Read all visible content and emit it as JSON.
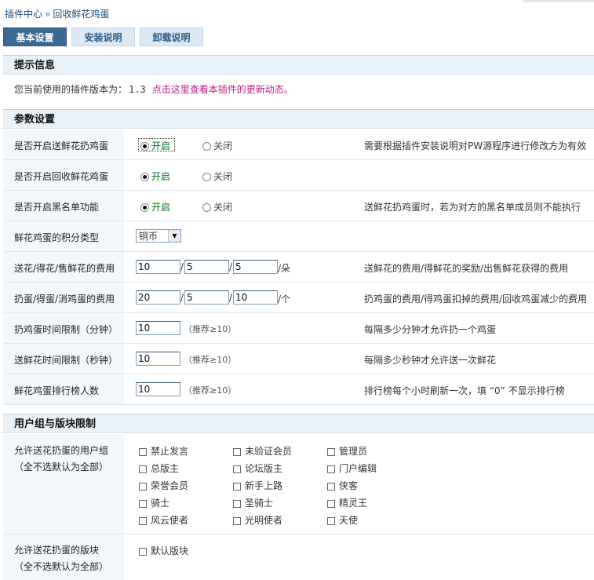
{
  "breadcrumb": {
    "home": "插件中心",
    "sep": "»",
    "current": "回收鲜花鸡蛋"
  },
  "tabs": [
    "基本设置",
    "安装说明",
    "卸载说明"
  ],
  "sections": {
    "notice": "提示信息",
    "params": "参数设置",
    "groups": "用户组与版块限制"
  },
  "notice": {
    "text": "您当前使用的插件版本为：",
    "version": "1.3",
    "link": "点击这里查看本插件的更新动态。"
  },
  "radio_labels": {
    "on": "开启",
    "off": "关闭"
  },
  "settings": {
    "r1": {
      "label": "是否开启送鲜花扔鸡蛋",
      "note": "需要根据插件安装说明对PW源程序进行修改方为有效"
    },
    "r2": {
      "label": "是否开启回收鲜花鸡蛋"
    },
    "r3": {
      "label": "是否开启黑名单功能",
      "note": "送鲜花扔鸡蛋时，若为对方的黑名单成员则不能执行"
    },
    "r4": {
      "label": "鲜花鸡蛋的积分类型",
      "select": "铜币"
    },
    "r5": {
      "label": "送花/得花/售鲜花的费用",
      "v1": "10",
      "v2": "5",
      "v3": "5",
      "unit": "朵",
      "note": "送鲜花的费用/得鲜花的奖励/出售鲜花获得的费用"
    },
    "r6": {
      "label": "扔蛋/得蛋/消鸡蛋的费用",
      "v1": "20",
      "v2": "5",
      "v3": "10",
      "unit": "个",
      "note": "扔鸡蛋的费用/得鸡蛋扣掉的费用/回收鸡蛋减少的费用"
    },
    "r7": {
      "label": "扔鸡蛋时间限制（分钟）",
      "v1": "10",
      "hint": "（推荐≥10）",
      "note": "每隔多少分钟才允许扔一个鸡蛋"
    },
    "r8": {
      "label": "送鲜花时间限制（秒钟）",
      "v1": "10",
      "hint": "（推荐≥10）",
      "note": "每隔多少秒钟才允许送一次鲜花"
    },
    "r9": {
      "label": "鲜花鸡蛋排行榜人数",
      "v1": "10",
      "hint": "（推荐≥10）",
      "note": "排行榜每个小时刷新一次，填 “0” 不显示排行榜"
    }
  },
  "groups": {
    "label1": "允许送花扔蛋的用户组",
    "sub": "（全不选默认为全部）",
    "items": [
      "禁止发言",
      "未验证会员",
      "管理员",
      "总版主",
      "论坛版主",
      "门户编辑",
      "荣誉会员",
      "新手上路",
      "侠客",
      "骑士",
      "圣骑士",
      "精灵王",
      "风云使者",
      "光明使者",
      "天使"
    ],
    "label2": "允许送花扔蛋的版块",
    "forum_items": [
      "默认版块"
    ]
  }
}
